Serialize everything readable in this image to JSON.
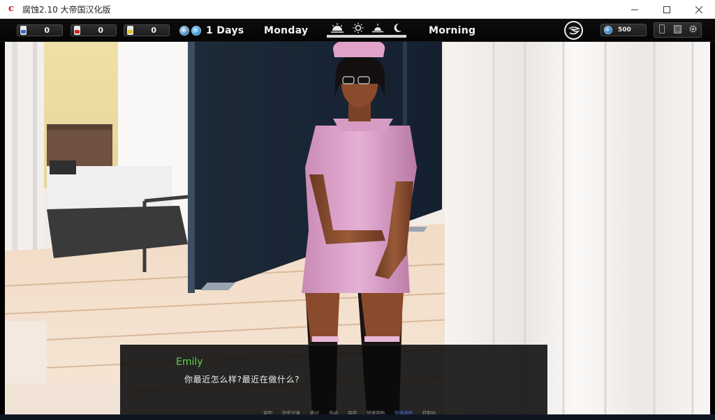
{
  "window": {
    "title": "腐蚀2.10 大帝国汉化版",
    "icon": "c"
  },
  "hud": {
    "resources": [
      {
        "icon": "vial-blue-icon",
        "value": "0",
        "color": "#2c6cd6"
      },
      {
        "icon": "vial-red-icon",
        "value": "0",
        "color": "#cf2424"
      },
      {
        "icon": "vial-yellow-icon",
        "value": "0",
        "color": "#e2c31e"
      }
    ],
    "days": "1 Days",
    "weekday": "Monday",
    "time_of_day": "Morning",
    "time_icons": [
      "sunrise-icon",
      "sun-icon",
      "sunset-icon",
      "moon-icon"
    ],
    "money": "500"
  },
  "dialogue": {
    "speaker": "Emily",
    "speaker_color": "#5bd44f",
    "text": "你最近怎么样?最近在做什么?"
  },
  "quick_menu": {
    "items": [
      "返回",
      "历史记录",
      "跳过",
      "自动",
      "保存",
      "快速存档",
      "快速读档",
      "控制台"
    ],
    "active_index": 6,
    "active_color": "#4a6ee6"
  }
}
